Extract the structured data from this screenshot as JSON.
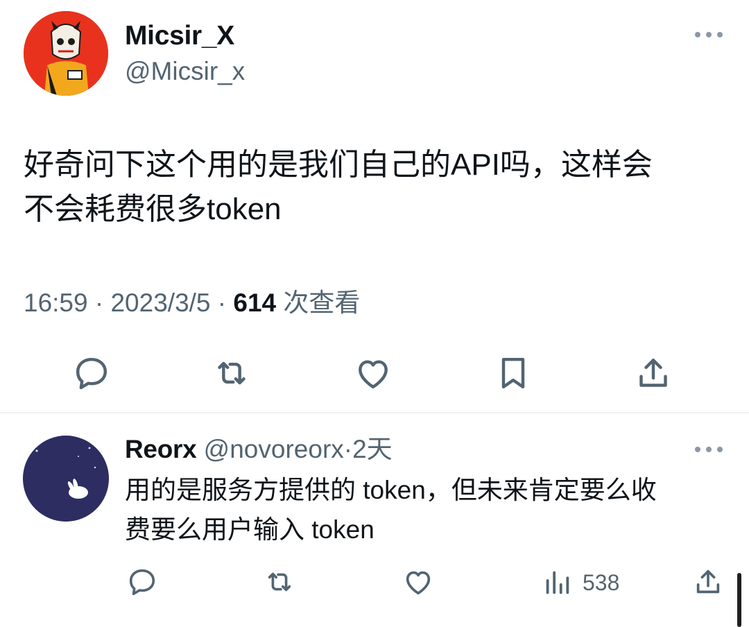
{
  "main_tweet": {
    "author_name": "Micsir_X",
    "author_handle": "@Micsir_x",
    "text": "好奇问下这个用的是我们自己的API吗，这样会\n不会耗费很多token",
    "time": "16:59",
    "separator": " · ",
    "date": "2023/3/5",
    "views_count": "614",
    "views_label": " 次查看",
    "actions": [
      "reply-icon",
      "retweet-icon",
      "like-icon",
      "bookmark-icon",
      "share-icon"
    ]
  },
  "reply": {
    "author_name": "Reorx",
    "author_handle": "@novoreorx",
    "separator": "·",
    "time_ago": "2天",
    "text": "用的是服务方提供的 token，但未来肯定要么收\n费要么用户输入 token",
    "views_count": "538",
    "actions": [
      "reply-icon",
      "retweet-icon",
      "like-icon",
      "views-icon",
      "share-icon"
    ]
  },
  "colors": {
    "text_primary": "#0f1419",
    "text_secondary": "#536471",
    "divider": "#eff3f4"
  }
}
